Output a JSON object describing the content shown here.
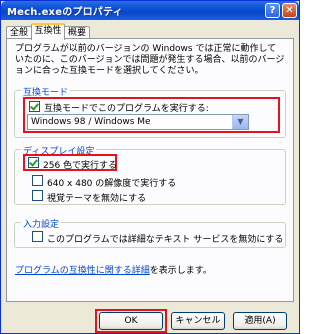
{
  "window": {
    "title": "Mech.exeのプロパティ"
  },
  "tabs": [
    {
      "label": "全般"
    },
    {
      "label": "互換性"
    },
    {
      "label": "概要"
    }
  ],
  "description": "プログラムが以前のバージョンの Windows では正常に動作していたのに、このバージョンでは問題が発生する場合、以前のバージョンに合った互換モードを選択してください。",
  "compat_mode": {
    "group_label": "互換モード",
    "checkbox_label": "互換モードでこのプログラムを実行する:",
    "checked": true,
    "selected_os": "Windows 98 / Windows Me"
  },
  "display": {
    "group_label": "ディスプレイ設定",
    "options": [
      {
        "label": "256 色で実行する",
        "checked": true
      },
      {
        "label": "640 x 480 の解像度で実行する",
        "checked": false
      },
      {
        "label": "視覚テーマを無効にする",
        "checked": false
      }
    ]
  },
  "input": {
    "group_label": "入力設定",
    "option_label": "このプログラムでは詳細なテキスト サービスを無効にする",
    "checked": false
  },
  "link": {
    "text": "プログラムの互換性に関する詳細",
    "suffix": "を表示します。"
  },
  "buttons": {
    "ok": "OK",
    "cancel": "キャンセル",
    "apply": "適用(A)"
  }
}
